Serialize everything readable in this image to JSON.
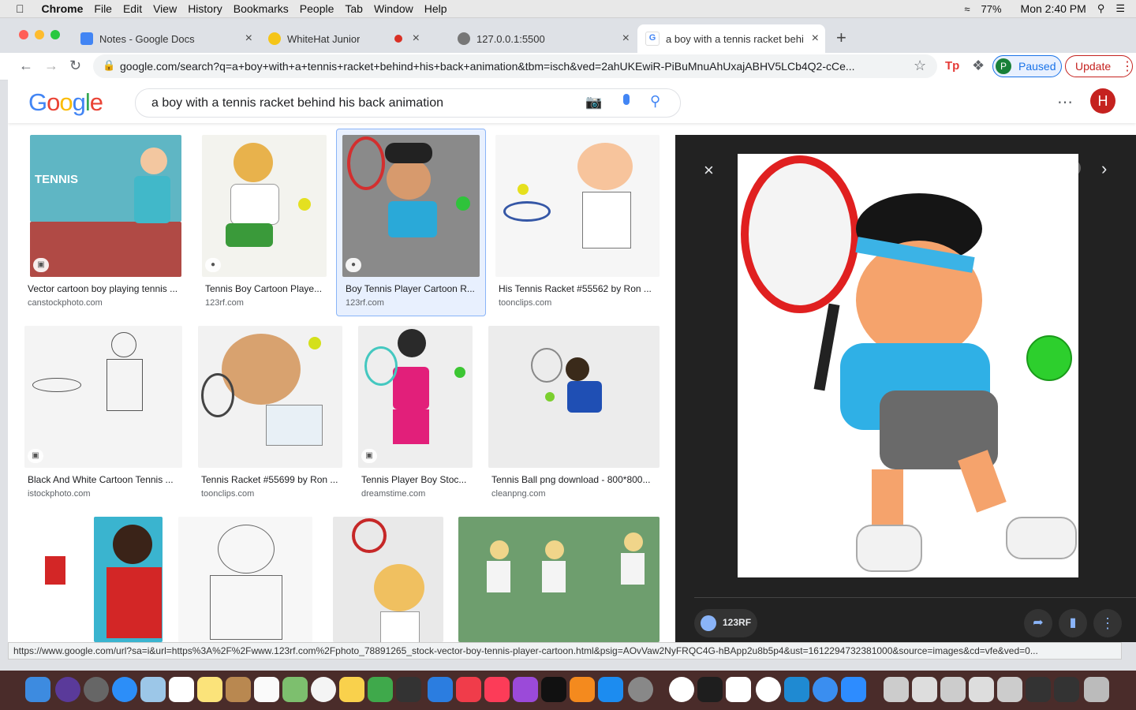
{
  "menubar": {
    "app": "Chrome",
    "items": [
      "File",
      "Edit",
      "View",
      "History",
      "Bookmarks",
      "People",
      "Tab",
      "Window",
      "Help"
    ],
    "battery": "77%",
    "clock": "Mon 2:40 PM"
  },
  "tabs": [
    {
      "title": "Notes - Google Docs",
      "icon": "docs-icon"
    },
    {
      "title": "WhiteHat Junior",
      "icon": "whitehat-icon"
    },
    {
      "title": "127.0.0.1:5500",
      "icon": "globe-icon"
    },
    {
      "title": "a boy with a tennis racket behi",
      "icon": "google-icon"
    }
  ],
  "toolbar": {
    "url": "google.com/search?q=a+boy+with+a+tennis+racket+behind+his+back+animation&tbm=isch&ved=2ahUKEwiR-PiBuMnuAhUxajABHV5LCb4Q2-cCe...",
    "paused_label": "Paused",
    "paused_avatar": "P",
    "update_label": "Update"
  },
  "google": {
    "logo": "Google",
    "query": "a boy with a tennis racket behind his back animation",
    "avatar": "H"
  },
  "results": [
    {
      "caption": "Vector cartoon boy playing tennis ...",
      "source": "canstockphoto.com",
      "color": "#5fb6c4"
    },
    {
      "caption": "Tennis Boy Cartoon Playe...",
      "source": "123rf.com",
      "color": "#f3f3ee"
    },
    {
      "caption": "Boy Tennis Player Cartoon R...",
      "source": "123rf.com",
      "color": "#8a8a8a"
    },
    {
      "caption": "His Tennis Racket #55562 by Ron ...",
      "source": "toonclips.com",
      "color": "#f6f6f6"
    },
    {
      "caption": "Black And White Cartoon Tennis ...",
      "source": "istockphoto.com",
      "color": "#f4f4f4"
    },
    {
      "caption": "Tennis Racket #55699 by Ron ...",
      "source": "toonclips.com",
      "color": "#f2f2f2"
    },
    {
      "caption": "Tennis Player Boy Stoc...",
      "source": "dreamstime.com",
      "color": "#eeeeee"
    },
    {
      "caption": "Tennis Ball png download - 800*800...",
      "source": "cleanpng.com",
      "color": "#ececec"
    }
  ],
  "preview": {
    "source_label": "123RF"
  },
  "statusbar": {
    "text": "https://www.google.com/url?sa=i&url=https%3A%2F%2Fwww.123rf.com%2Fphoto_78891265_stock-vector-boy-tennis-player-cartoon.html&psig=AOvVaw2NyFRQC4G-hBApp2u8b5p4&ust=1612294732381000&source=images&cd=vfe&ved=0..."
  },
  "colors": {
    "google_blue": "#4285f4",
    "google_red": "#ea4335",
    "google_yellow": "#fbbc05",
    "google_green": "#34a853",
    "preview_bg": "#222222",
    "avatar_red": "#c5221f"
  }
}
